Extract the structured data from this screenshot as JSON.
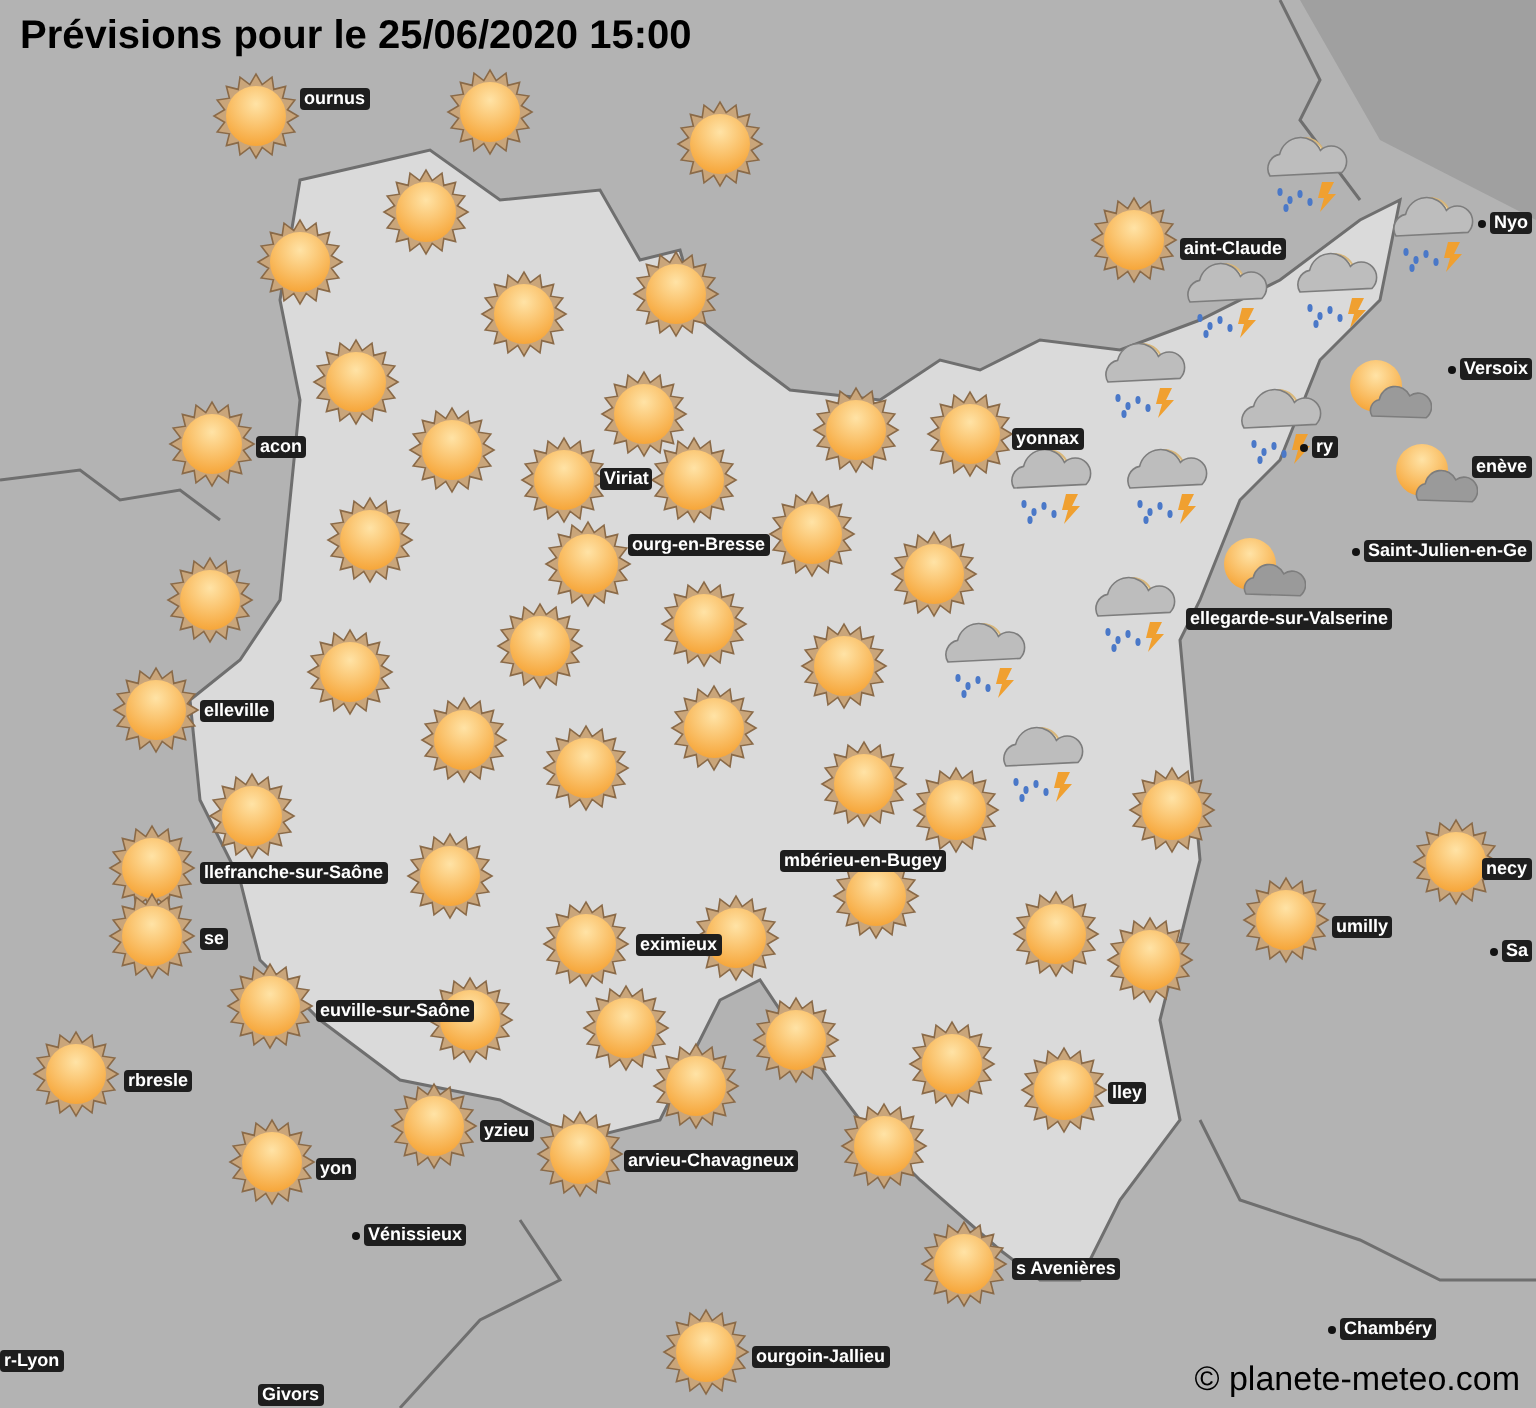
{
  "title": "Prévisions pour le 25/06/2020 15:00",
  "forecasts": [
    {
      "kind": "sun"
    },
    {
      "kind": "sun"
    },
    {
      "kind": "sun"
    },
    {
      "kind": "sun"
    },
    {
      "kind": "sun"
    },
    {
      "kind": "sun"
    },
    {
      "kind": "sun"
    },
    {
      "kind": "sun"
    },
    {
      "kind": "sun"
    },
    {
      "kind": "sun"
    },
    {
      "kind": "sun"
    },
    {
      "kind": "sun"
    },
    {
      "kind": "sun"
    },
    {
      "kind": "sun"
    },
    {
      "kind": "sun"
    },
    {
      "kind": "sun"
    },
    {
      "kind": "sun"
    },
    {
      "kind": "sun"
    },
    {
      "kind": "sun"
    },
    {
      "kind": "sun"
    },
    {
      "kind": "sun"
    },
    {
      "kind": "sun"
    },
    {
      "kind": "sun"
    },
    {
      "kind": "sun"
    },
    {
      "kind": "sun"
    },
    {
      "kind": "sun"
    },
    {
      "kind": "sun"
    },
    {
      "kind": "sun"
    },
    {
      "kind": "sun"
    },
    {
      "kind": "sun"
    },
    {
      "kind": "sun"
    },
    {
      "kind": "sun"
    },
    {
      "kind": "sun"
    },
    {
      "kind": "sun"
    },
    {
      "kind": "sun"
    },
    {
      "kind": "sun"
    },
    {
      "kind": "sun"
    },
    {
      "kind": "sun"
    },
    {
      "kind": "sun"
    },
    {
      "kind": "sun"
    },
    {
      "kind": "sun"
    },
    {
      "kind": "sun"
    },
    {
      "kind": "sun"
    },
    {
      "kind": "sun"
    },
    {
      "kind": "sun"
    },
    {
      "kind": "sun"
    },
    {
      "kind": "sun"
    },
    {
      "kind": "sun"
    },
    {
      "kind": "sun"
    },
    {
      "kind": "sun"
    },
    {
      "kind": "sun"
    },
    {
      "kind": "sun"
    },
    {
      "kind": "sun"
    },
    {
      "kind": "sun"
    },
    {
      "kind": "sun"
    },
    {
      "kind": "sun"
    },
    {
      "kind": "sun"
    },
    {
      "kind": "storm"
    },
    {
      "kind": "storm"
    },
    {
      "kind": "storm"
    },
    {
      "kind": "storm"
    },
    {
      "kind": "storm"
    },
    {
      "kind": "storm"
    },
    {
      "kind": "storm"
    },
    {
      "kind": "storm"
    },
    {
      "kind": "storm"
    },
    {
      "kind": "storm"
    },
    {
      "kind": "storm"
    },
    {
      "kind": "sun-cloud"
    },
    {
      "kind": "sun-cloud"
    },
    {
      "kind": "sun-cloud"
    }
  ],
  "towns": [
    {
      "label": "ournus",
      "dot": false
    },
    {
      "label": "Nyo",
      "dot": true
    },
    {
      "label": "aint-Claude",
      "dot": false
    },
    {
      "label": "Versoix",
      "dot": true
    },
    {
      "label": "acon",
      "dot": false
    },
    {
      "label": "ry",
      "dot": true
    },
    {
      "label": "yonnax",
      "dot": false
    },
    {
      "label": "enève",
      "dot": false
    },
    {
      "label": "Viriat",
      "dot": false
    },
    {
      "label": "ourg-en-Bresse",
      "dot": false
    },
    {
      "label": "Saint-Julien-en-Ge",
      "dot": true
    },
    {
      "label": "ellegarde-sur-Valserine",
      "dot": false
    },
    {
      "label": "elleville",
      "dot": false
    },
    {
      "label": "mbérieu-en-Bugey",
      "dot": false
    },
    {
      "label": "llefranche-sur-Saône",
      "dot": false
    },
    {
      "label": "necy",
      "dot": false
    },
    {
      "label": "umilly",
      "dot": false
    },
    {
      "label": "se",
      "dot": false
    },
    {
      "label": "eximieux",
      "dot": false
    },
    {
      "label": "Sa",
      "dot": true
    },
    {
      "label": "euville-sur-Saône",
      "dot": false
    },
    {
      "label": "rbresle",
      "dot": false
    },
    {
      "label": "lley",
      "dot": false
    },
    {
      "label": "yzieu",
      "dot": false
    },
    {
      "label": "arvieu-Chavagneux",
      "dot": false
    },
    {
      "label": "yon",
      "dot": false
    },
    {
      "label": "Vénissieux",
      "dot": true
    },
    {
      "label": "s Avenières",
      "dot": false
    },
    {
      "label": "Chambéry",
      "dot": true
    },
    {
      "label": "r-Lyon",
      "dot": false
    },
    {
      "label": "ourgoin-Jallieu",
      "dot": false
    },
    {
      "label": "Givors",
      "dot": false
    }
  ],
  "copyright": "© planete-meteo.com"
}
